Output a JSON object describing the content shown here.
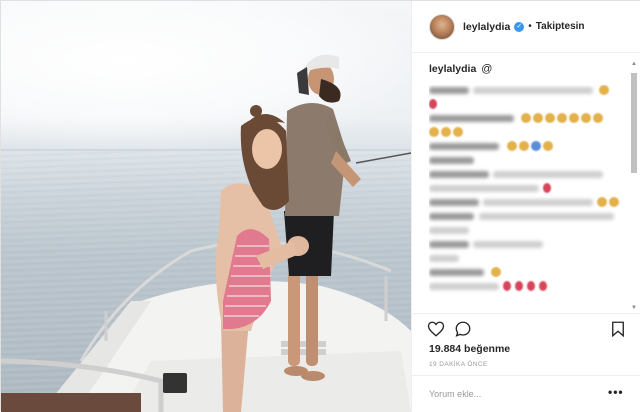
{
  "post": {
    "header": {
      "username": "leylalydia",
      "separator": "•",
      "follow_state": "Takiptesin"
    },
    "caption": {
      "username": "leylalydia"
    },
    "icons": {
      "verified": "verified-badge-icon",
      "caption_emoji": "spiral-emoji-icon",
      "like": "heart-icon",
      "comment": "comment-bubble-icon",
      "save": "bookmark-icon",
      "more": "more-options-icon"
    },
    "stats": {
      "likes": "19.884 beğenme",
      "time_ago": "19 DAKİKA ÖNCE"
    },
    "comment_form": {
      "placeholder": "Yorum ekle...",
      "more_label": "•••"
    },
    "colors": {
      "verified_blue": "#3897f0",
      "text": "#262626",
      "muted": "#999999"
    }
  }
}
